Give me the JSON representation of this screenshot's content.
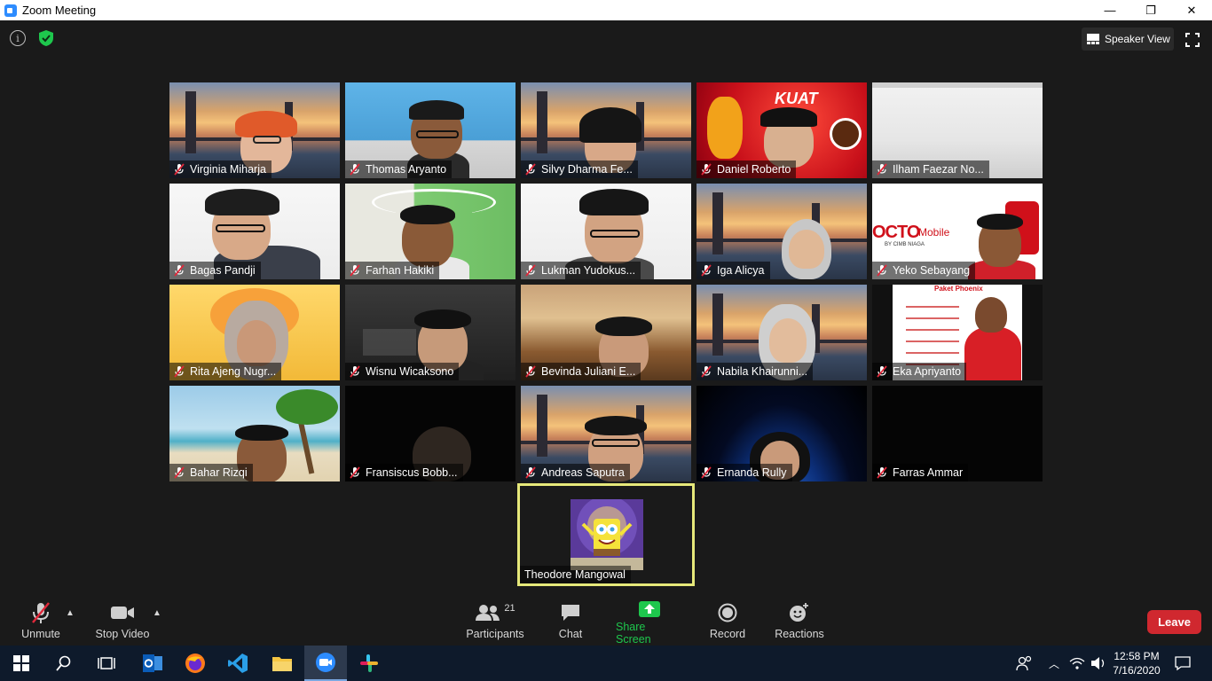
{
  "window": {
    "title": "Zoom Meeting",
    "minimize": "—",
    "restore": "❐",
    "close": "✕"
  },
  "header": {
    "info_glyph": "i",
    "speaker_view_label": "Speaker View",
    "shield_color": "#1ec74d"
  },
  "participants": [
    "Virginia Miharja",
    "Thomas Aryanto",
    "Silvy Dharma Fe...",
    "Daniel Roberto",
    "Ilham Faezar No...",
    "Bagas Pandji",
    "Farhan Hakiki",
    "Lukman Yudokus...",
    "Iga Alicya",
    "Yeko Sebayang",
    "Rita Ajeng Nugr...",
    "Wisnu Wicaksono",
    "Bevinda Juliani E...",
    "Nabila Khairunni...",
    "Eka Apriyanto",
    "Bahar Rizqi",
    "Fransiscus Bobb...",
    "Andreas Saputra",
    "Ernanda Rully",
    "Farras Ammar"
  ],
  "self_view": {
    "name": "Theodore Mangowal"
  },
  "tile_text": {
    "octo": "OCTO",
    "mobile": "Mobile",
    "cimb": "BY CIMB NIAGA",
    "rekuat": "KUAT",
    "phoenix": "Paket Phoenix"
  },
  "toolbar": {
    "unmute": "Unmute",
    "stop_video": "Stop Video",
    "participants": "Participants",
    "participants_count": "21",
    "chat": "Chat",
    "share_screen": "Share Screen",
    "record": "Record",
    "reactions": "Reactions",
    "leave": "Leave"
  },
  "taskbar": {
    "time": "12:58 PM",
    "date": "7/16/2020"
  },
  "colors": {
    "accent": "#2d8cff",
    "share": "#1ec74d",
    "leave": "#d0282f",
    "self_border": "#e6e87a"
  }
}
